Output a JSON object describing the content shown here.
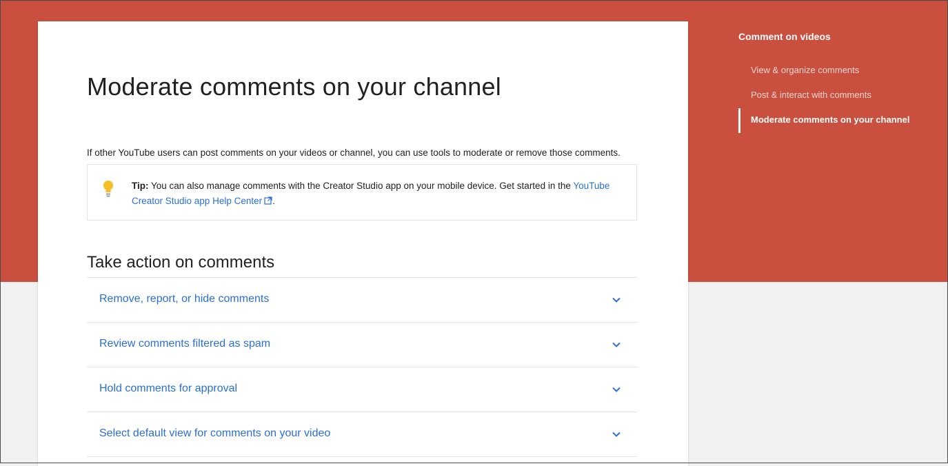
{
  "article": {
    "title": "Moderate comments on your channel",
    "intro": "If other YouTube users can post comments on your videos or channel, you can use tools to moderate or remove those comments.",
    "tip": {
      "label": "Tip:",
      "text": " You can also manage comments with the Creator Studio app on your mobile device. Get started in the ",
      "link_text": "YouTube Creator Studio app Help Center",
      "trailing": ".",
      "icon": "lightbulb-icon",
      "icon_color": "#f6bf26"
    },
    "section_heading": "Take action on comments",
    "accordion_items": [
      {
        "label": "Remove, report, or hide comments"
      },
      {
        "label": "Review comments filtered as spam"
      },
      {
        "label": "Hold comments for approval"
      },
      {
        "label": "Select default view for comments on your video"
      }
    ]
  },
  "side_nav": {
    "title": "Comment on videos",
    "items": [
      {
        "label": "View & organize comments",
        "active": false
      },
      {
        "label": "Post & interact with comments",
        "active": false
      },
      {
        "label": "Moderate comments on your channel",
        "active": true
      }
    ]
  },
  "colors": {
    "banner": "#c94f3f",
    "link": "#2a6fd6",
    "background": "#f1f1f1"
  }
}
